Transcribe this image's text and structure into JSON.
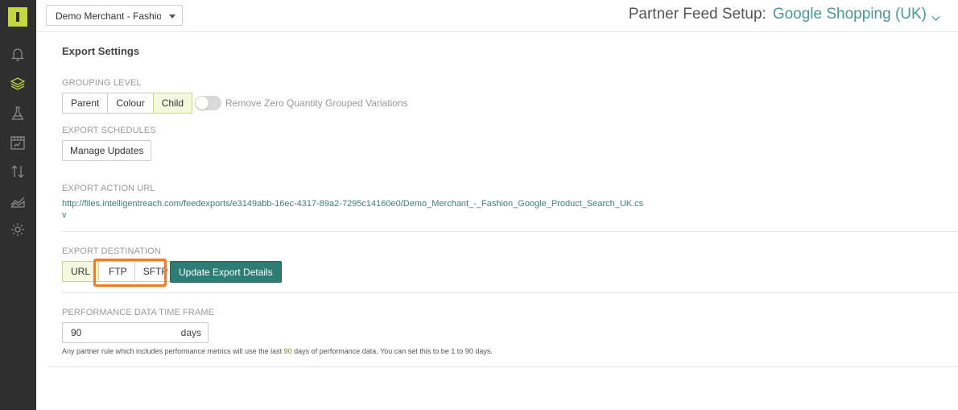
{
  "sidebar": {
    "items": [
      {
        "name": "bell-icon"
      },
      {
        "name": "layers-icon"
      },
      {
        "name": "flask-icon"
      },
      {
        "name": "storefront-icon"
      },
      {
        "name": "transfer-arrows-icon"
      },
      {
        "name": "area-chart-icon"
      },
      {
        "name": "gear-icon"
      }
    ],
    "logo_color": "#c5d73b"
  },
  "topbar": {
    "merchant": "Demo Merchant - Fashion",
    "title_prefix": "Partner Feed Setup:",
    "feed_name": "Google Shopping (UK)"
  },
  "export": {
    "section_title": "Export Settings",
    "grouping": {
      "label": "GROUPING LEVEL",
      "options": [
        "Parent",
        "Colour",
        "Child"
      ],
      "selected": "Child",
      "toggle_label": "Remove Zero Quantity Grouped Variations",
      "toggle_on": false
    },
    "schedules": {
      "label": "EXPORT SCHEDULES",
      "button": "Manage Updates"
    },
    "action_url": {
      "label": "EXPORT ACTION URL",
      "url": "http://files.intelligentreach.com/feedexports/e3149abb-16ec-4317-89a2-7295c14160e0/Demo_Merchant_-_Fashion_Google_Product_Search_UK.csv"
    },
    "destination": {
      "label": "EXPORT DESTINATION",
      "options": [
        "URL",
        "FTP",
        "SFTP"
      ],
      "selected": "URL",
      "update_button": "Update Export Details"
    },
    "performance": {
      "label": "PERFORMANCE DATA TIME FRAME",
      "value": "90",
      "unit": "days",
      "help_before": "Any partner rule which includes performance metrics will use the last",
      "help_num": "90",
      "help_after": "days of performance data. You can set this to be 1 to 90 days."
    }
  },
  "colors": {
    "accent": "#4a9a93",
    "primary_button": "#2e7d74",
    "active_option": "#f3f8df",
    "highlight": "#f47c20"
  }
}
